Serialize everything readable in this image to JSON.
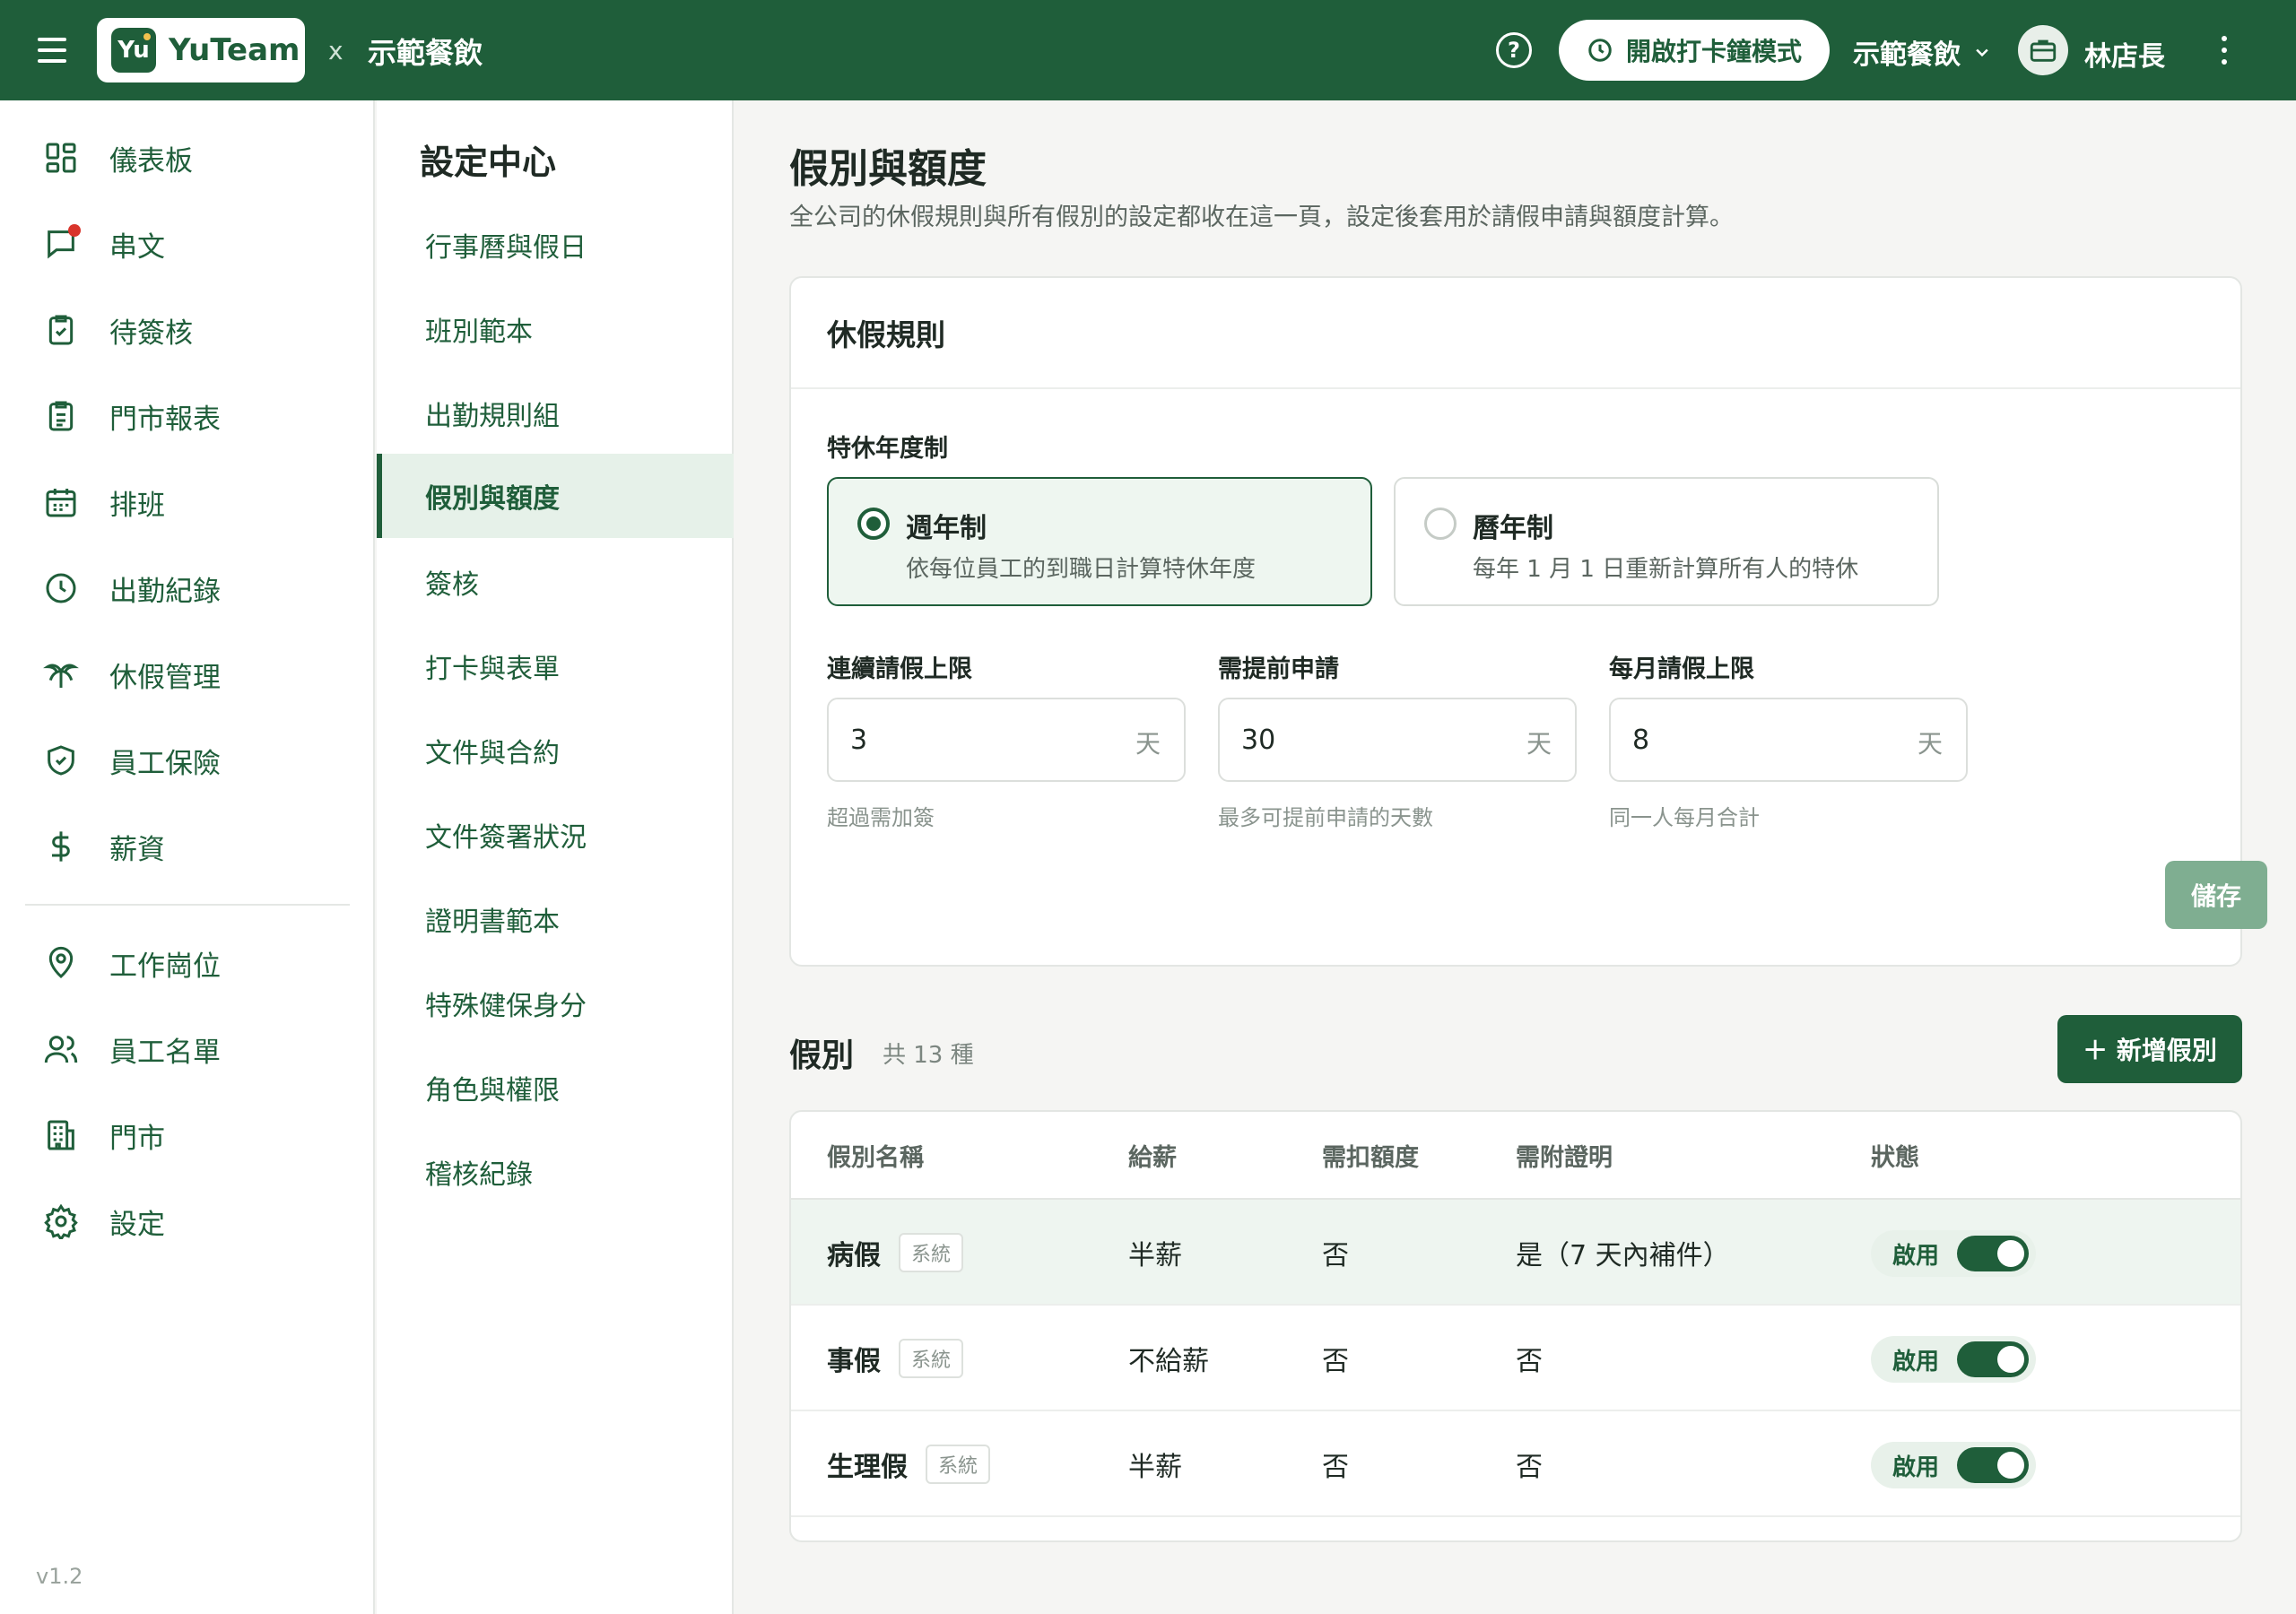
{
  "topbar": {
    "logo_mark": "Yu",
    "logo_text": "YuTeam",
    "separator": "x",
    "org_name": "示範餐飲",
    "clock_mode_label": "開啟打卡鐘模式",
    "store_select": "示範餐飲",
    "user_name": "林店長",
    "help_symbol": "?"
  },
  "sidebar": {
    "items": [
      {
        "label": "儀表板",
        "icon": "dashboard-icon"
      },
      {
        "label": "串文",
        "icon": "chat-icon"
      },
      {
        "label": "待簽核",
        "icon": "clipboard-check-icon"
      },
      {
        "label": "門市報表",
        "icon": "report-icon"
      },
      {
        "label": "排班",
        "icon": "calendar-icon"
      },
      {
        "label": "出勤紀錄",
        "icon": "clock-icon"
      },
      {
        "label": "休假管理",
        "icon": "palm-tree-icon"
      },
      {
        "label": "員工保險",
        "icon": "shield-check-icon"
      },
      {
        "label": "薪資",
        "icon": "dollar-icon"
      },
      {
        "label": "工作崗位",
        "icon": "location-pin-icon"
      },
      {
        "label": "員工名單",
        "icon": "users-icon"
      },
      {
        "label": "門市",
        "icon": "building-icon"
      },
      {
        "label": "設定",
        "icon": "gear-icon"
      }
    ],
    "version": "v1.2"
  },
  "subnav": {
    "title": "設定中心",
    "items": [
      "行事曆與假日",
      "班別範本",
      "出勤規則組",
      "假別與額度",
      "簽核",
      "打卡與表單",
      "文件與合約",
      "文件簽署狀況",
      "證明書範本",
      "特殊健保身分",
      "角色與權限",
      "稽核紀錄"
    ],
    "active": "假別與額度"
  },
  "page": {
    "title": "假別與額度",
    "description": "全公司的休假規則與所有假別的設定都收在這一頁，設定後套用於請假申請與額度計算。"
  },
  "rules": {
    "title": "休假規則",
    "year_system_label": "特休年度制",
    "options": [
      {
        "title": "週年制",
        "desc": "依每位員工的到職日計算特休年度",
        "selected": true
      },
      {
        "title": "曆年制",
        "desc": "每年 1 月 1 日重新計算所有人的特休",
        "selected": false
      }
    ],
    "fields": [
      {
        "label": "連續請假上限",
        "value": "3",
        "unit": "天",
        "hint": "超過需加簽"
      },
      {
        "label": "需提前申請",
        "value": "30",
        "unit": "天",
        "hint": "最多可提前申請的天數"
      },
      {
        "label": "每月請假上限",
        "value": "8",
        "unit": "天",
        "hint": "同一人每月合計"
      }
    ],
    "save_label": "儲存"
  },
  "leave_types": {
    "title": "假別",
    "count_label": "共 13 種",
    "add_label": "＋ 新增假別",
    "headers": [
      "假別名稱",
      "給薪",
      "需扣額度",
      "需附證明",
      "狀態"
    ],
    "rows": [
      {
        "name": "病假",
        "tag": "系統",
        "pay": "半薪",
        "deduct": "否",
        "proof": "是（7 天內補件）",
        "status": "啟用"
      },
      {
        "name": "事假",
        "tag": "系統",
        "pay": "不給薪",
        "deduct": "否",
        "proof": "否",
        "status": "啟用"
      },
      {
        "name": "生理假",
        "tag": "系統",
        "pay": "半薪",
        "deduct": "否",
        "proof": "否",
        "status": "啟用"
      }
    ]
  },
  "colors": {
    "brand": "#1f5e3a",
    "accent_light": "#eef6f0",
    "alert": "#d9342b"
  }
}
